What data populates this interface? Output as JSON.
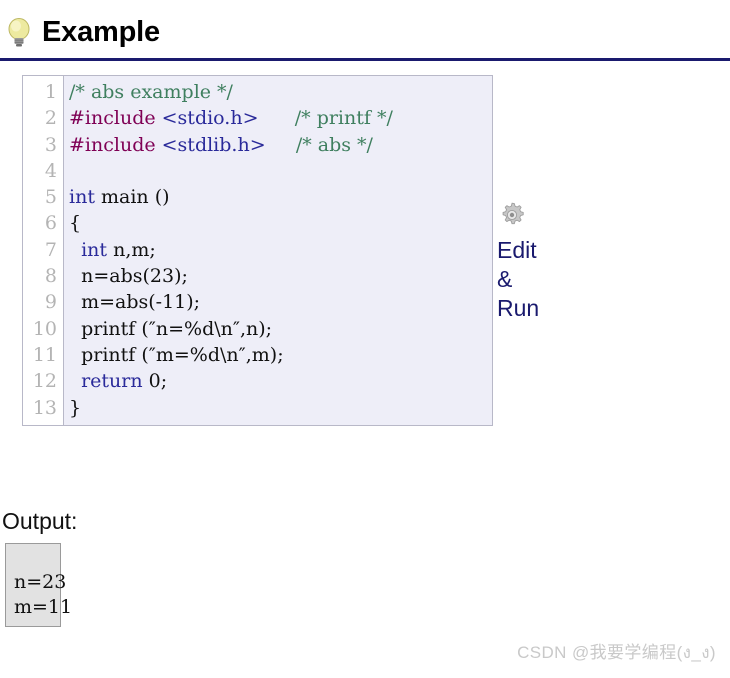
{
  "header": {
    "title": "Example",
    "icon": "lightbulb-icon",
    "rule_color": "#1a1a6e"
  },
  "code_block": {
    "language": "c",
    "background": "#eeeef8",
    "border_color": "#b8b8c8",
    "line_numbers": [
      "1",
      "2",
      "3",
      "4",
      "5",
      "6",
      "7",
      "8",
      "9",
      "10",
      "11",
      "12",
      "13"
    ],
    "lines": [
      [
        {
          "t": "/* abs example */",
          "c": "cmt"
        }
      ],
      [
        {
          "t": "#include ",
          "c": "pre"
        },
        {
          "t": "<stdio.h>",
          "c": "inc"
        },
        {
          "t": "      ",
          "c": "plain"
        },
        {
          "t": "/* printf */",
          "c": "cmt"
        }
      ],
      [
        {
          "t": "#include ",
          "c": "pre"
        },
        {
          "t": "<stdlib.h>",
          "c": "inc"
        },
        {
          "t": "     ",
          "c": "plain"
        },
        {
          "t": "/* abs */",
          "c": "cmt"
        }
      ],
      [
        {
          "t": "",
          "c": "plain"
        }
      ],
      [
        {
          "t": "int",
          "c": "kw"
        },
        {
          "t": " main ()",
          "c": "plain"
        }
      ],
      [
        {
          "t": "{",
          "c": "plain"
        }
      ],
      [
        {
          "t": "  ",
          "c": "plain"
        },
        {
          "t": "int",
          "c": "kw"
        },
        {
          "t": " n,m;",
          "c": "plain"
        }
      ],
      [
        {
          "t": "  n=abs(23);",
          "c": "plain"
        }
      ],
      [
        {
          "t": "  m=abs(-11);",
          "c": "plain"
        }
      ],
      [
        {
          "t": "  printf (″n=%d\\n″,n);",
          "c": "plain"
        }
      ],
      [
        {
          "t": "  printf (″m=%d\\n″,m);",
          "c": "plain"
        }
      ],
      [
        {
          "t": "  ",
          "c": "plain"
        },
        {
          "t": "return",
          "c": "kw"
        },
        {
          "t": " 0;",
          "c": "plain"
        }
      ],
      [
        {
          "t": "}",
          "c": "plain"
        }
      ]
    ]
  },
  "edit_run": {
    "icon": "gear-icon",
    "label": "Edit\n&\nRun",
    "color": "#1a1a6e"
  },
  "output": {
    "label": "Output:",
    "text": "n=23\nm=11",
    "box_background": "#e2e2e2",
    "box_border": "#9a9a9a"
  },
  "watermark": {
    "text": "CSDN @我要学编程(ง_ง)"
  }
}
